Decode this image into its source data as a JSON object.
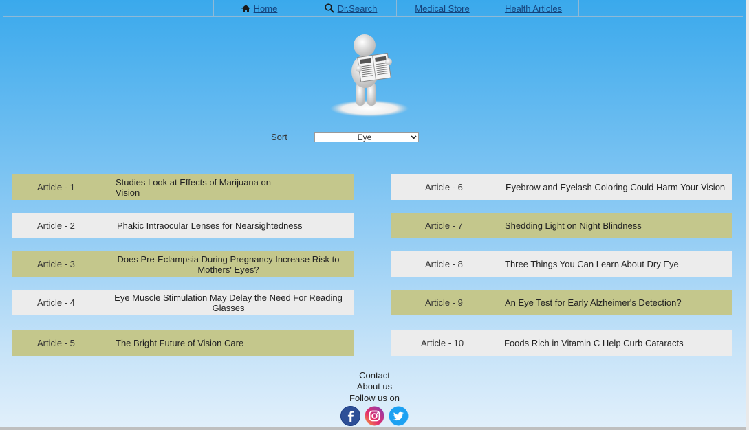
{
  "nav": {
    "items": [
      {
        "label": "Home",
        "icon": "home-icon"
      },
      {
        "label": "Dr.Search",
        "icon": "search-icon"
      },
      {
        "label": "Medical Store"
      },
      {
        "label": "Health Articles"
      }
    ]
  },
  "sort": {
    "label": "Sort",
    "selected": "Eye"
  },
  "articles": {
    "left": [
      {
        "num": "Article - 1",
        "title": "Studies Look at Effects of Marijuana on Vision"
      },
      {
        "num": "Article - 2",
        "title": "Phakic Intraocular Lenses for Nearsightedness"
      },
      {
        "num": "Article - 3",
        "title": "Does Pre-Eclampsia During Pregnancy Increase Risk to Mothers' Eyes?"
      },
      {
        "num": "Article - 4",
        "title": "Eye Muscle Stimulation May Delay the Need For Reading Glasses"
      },
      {
        "num": "Article - 5",
        "title": "The Bright Future of Vision Care"
      }
    ],
    "right": [
      {
        "num": "Article - 6",
        "title": "Eyebrow and Eyelash Coloring Could Harm Your Vision"
      },
      {
        "num": "Article - 7",
        "title": "Shedding Light on Night Blindness"
      },
      {
        "num": "Article - 8",
        "title": "Three Things You Can Learn About Dry Eye"
      },
      {
        "num": "Article - 9",
        "title": "An Eye Test for Early Alzheimer's Detection?"
      },
      {
        "num": "Article - 10",
        "title": "Foods Rich in Vitamin C Help Curb Cataracts"
      }
    ]
  },
  "footer": {
    "contact": "Contact",
    "about": "About us",
    "follow": "Follow us on",
    "social": [
      "facebook-icon",
      "instagram-icon",
      "twitter-icon"
    ]
  },
  "colors": {
    "olive_row": "#c4c78c",
    "grey_row": "#ececec",
    "nav_link": "#16427a"
  }
}
